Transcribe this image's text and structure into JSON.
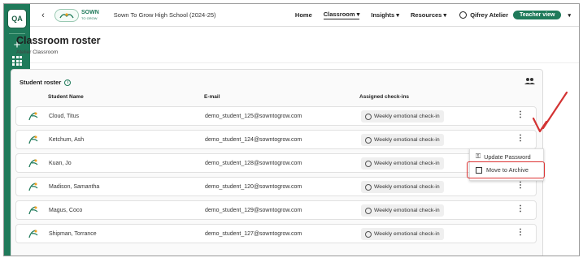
{
  "rail": {
    "workspace_badge": "QA",
    "add_label": "+",
    "apps_icon": "grid-icon"
  },
  "topbar": {
    "back": "‹",
    "logo_main": "SOWN",
    "logo_sub": "TO GROW",
    "school": "Sown To Grow High School (2024-25)",
    "nav": [
      "Home",
      "Classroom ▾",
      "Insights ▾",
      "Resources ▾"
    ],
    "user_name": "Qifrey Atelier",
    "view_button": "Teacher view",
    "caret": "▾"
  },
  "page": {
    "title": "Classroom roster",
    "subtitle": "Atelier Classroom"
  },
  "roster": {
    "title": "Student roster",
    "columns": {
      "name": "Student Name",
      "email": "E-mail",
      "checkins": "Assigned check-ins"
    },
    "rows": [
      {
        "name": "Cloud, Titus",
        "email": "demo_student_125@sowntogrow.com",
        "checkin": "Weekly emotional check-in"
      },
      {
        "name": "Ketchum, Ash",
        "email": "demo_student_124@sowntogrow.com",
        "checkin": "Weekly emotional check-in"
      },
      {
        "name": "Kuan, Jo",
        "email": "demo_student_128@sowntogrow.com",
        "checkin": "Weekly emotional check-in"
      },
      {
        "name": "Madison, Samantha",
        "email": "demo_student_120@sowntogrow.com",
        "checkin": "Weekly emotional check-in"
      },
      {
        "name": "Magus, Coco",
        "email": "demo_student_129@sowntogrow.com",
        "checkin": "Weekly emotional check-in"
      },
      {
        "name": "Shipman, Torrance",
        "email": "demo_student_127@sowntogrow.com",
        "checkin": "Weekly emotional check-in"
      }
    ],
    "kebab": "⋮"
  },
  "menu": {
    "update_password": "Update Password",
    "move_to_archive": "Move to Archive"
  },
  "colors": {
    "brand": "#1f7a5a",
    "annotation": "#d33333"
  }
}
